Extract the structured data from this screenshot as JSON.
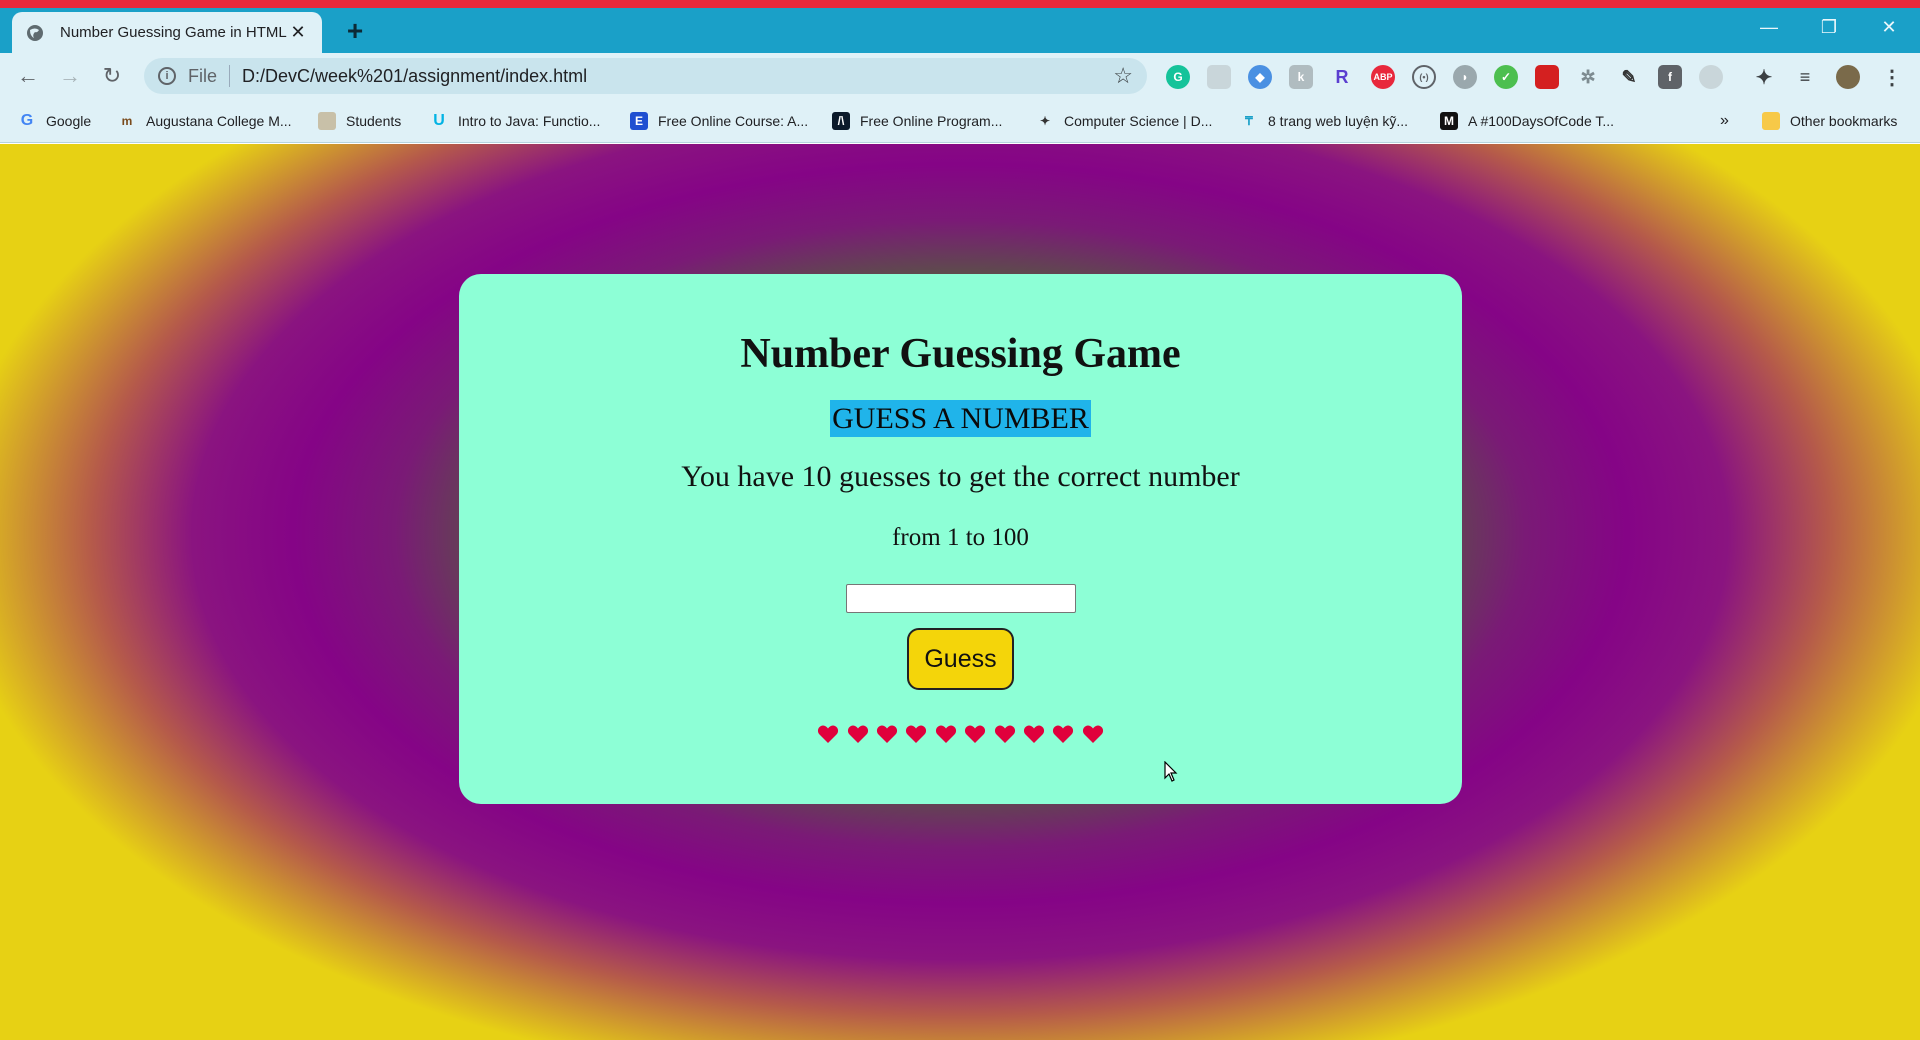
{
  "browser": {
    "tab_title": "Number Guessing Game in HTML",
    "scheme": "File",
    "url": "D:/DevC/week%201/assignment/index.html",
    "bookmarks": [
      {
        "label": "Google",
        "icon": "google-icon"
      },
      {
        "label": "Augustana College M...",
        "icon": "college-icon"
      },
      {
        "label": "Students",
        "icon": "students-icon"
      },
      {
        "label": "Intro to Java: Functio...",
        "icon": "udacity-icon"
      },
      {
        "label": "Free Online Course: A...",
        "icon": "course-icon"
      },
      {
        "label": "Free Online Program...",
        "icon": "program-icon"
      },
      {
        "label": "Computer Science | D...",
        "icon": "cs-icon"
      },
      {
        "label": "8 trang web luyện kỹ...",
        "icon": "web-icon"
      },
      {
        "label": "A #100DaysOfCode T...",
        "icon": "medium-icon"
      }
    ],
    "overflow": "»",
    "other_bookmarks": "Other bookmarks"
  },
  "game": {
    "title": "Number Guessing Game",
    "subtitle": "GUESS A NUMBER",
    "instructions": "You have 10 guesses to get the correct number",
    "range": "from 1 to 100",
    "input_value": "",
    "button_label": "Guess",
    "lives": 10
  },
  "colors": {
    "card_bg": "#8dffd6",
    "button_bg": "#f4d50a",
    "heart": "#e0003c",
    "highlight": "#20b4ea"
  }
}
